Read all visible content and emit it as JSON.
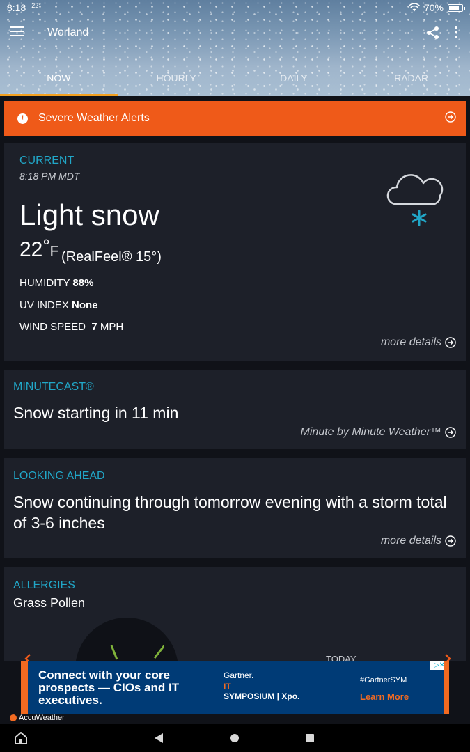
{
  "status": {
    "time": "8:18",
    "temp": "22°",
    "battery": "70%"
  },
  "appbar": {
    "location": "Worland"
  },
  "tabs": [
    "NOW",
    "HOURLY",
    "DAILY",
    "RADAR"
  ],
  "alert": {
    "label": "Severe Weather Alerts"
  },
  "current": {
    "title": "CURRENT",
    "time": "8:18 PM MDT",
    "condition": "Light snow",
    "temperature": "22",
    "unit": "F",
    "realfeel": "(RealFeel® 15°)",
    "humidity_label": "HUMIDITY",
    "humidity_value": "88%",
    "uv_label": "UV INDEX",
    "uv_value": "None",
    "wind_label": "WIND SPEED",
    "wind_value": "7",
    "wind_unit": "MPH",
    "more": "more details",
    "icon": "snow-cloud-icon",
    "icon_color": "#21a7c8"
  },
  "minutecast": {
    "title": "MINUTECAST®",
    "headline": "Snow starting in 11 min",
    "link": "Minute by Minute Weather™"
  },
  "looking_ahead": {
    "title": "LOOKING AHEAD",
    "headline": "Snow continuing through tomorrow evening with a storm total of 3-6 inches",
    "more": "more details"
  },
  "allergies": {
    "title": "ALLERGIES",
    "subtitle": "Grass Pollen",
    "day": "TODAY"
  },
  "ad": {
    "headline": "Connect with your core prospects — CIOs and IT executives.",
    "brand": "Gartner.",
    "it": "IT",
    "symposium": "SYMPOSIUM | Xpo.",
    "tag": "#GartnerSYM",
    "cta": "Learn More",
    "adchoice": "▷✕"
  },
  "footer": {
    "logo": "AccuWeather"
  },
  "colors": {
    "accent": "#21a7c8",
    "alert": "#ef5a19",
    "tab_indicator": "#f2a020",
    "card": "#1d2029"
  }
}
